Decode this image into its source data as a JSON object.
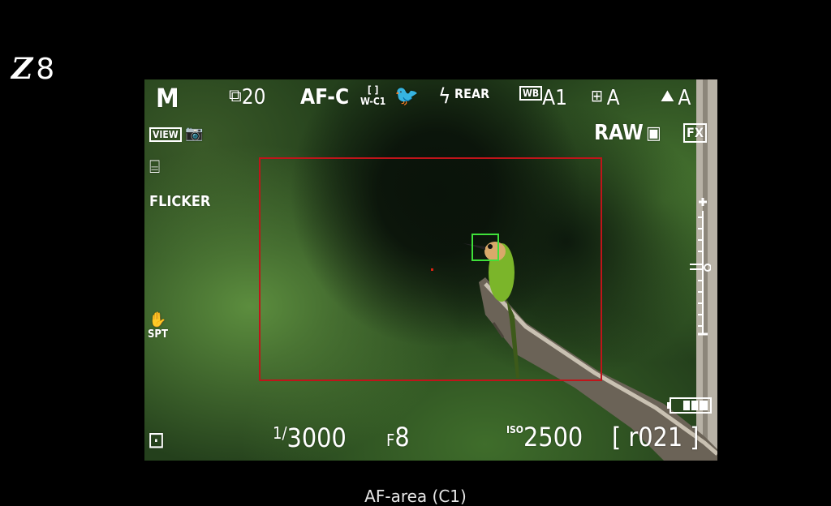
{
  "camera_model": {
    "logo": "Z",
    "number": "8"
  },
  "caption": "AF-area (C1)",
  "top_bar": {
    "mode": "M",
    "release": "20",
    "focus_mode": "AF-C",
    "area_mode": "W-C1",
    "flash": "REAR",
    "wb": "A1",
    "picture_control": "A",
    "adl": "A"
  },
  "right_info": {
    "format": "RAW",
    "area": "FX"
  },
  "left_info": {
    "view": "VIEW",
    "flicker": "FLICKER",
    "vr": "SPT"
  },
  "bottom_bar": {
    "shutter_prefix": "1/",
    "shutter": "3000",
    "aperture_prefix": "F",
    "aperture": "8",
    "iso_label": "ISO",
    "iso": "2500",
    "frames": "r021"
  },
  "colors": {
    "af_area": "#c0141a",
    "af_point": "#3fe03a"
  }
}
